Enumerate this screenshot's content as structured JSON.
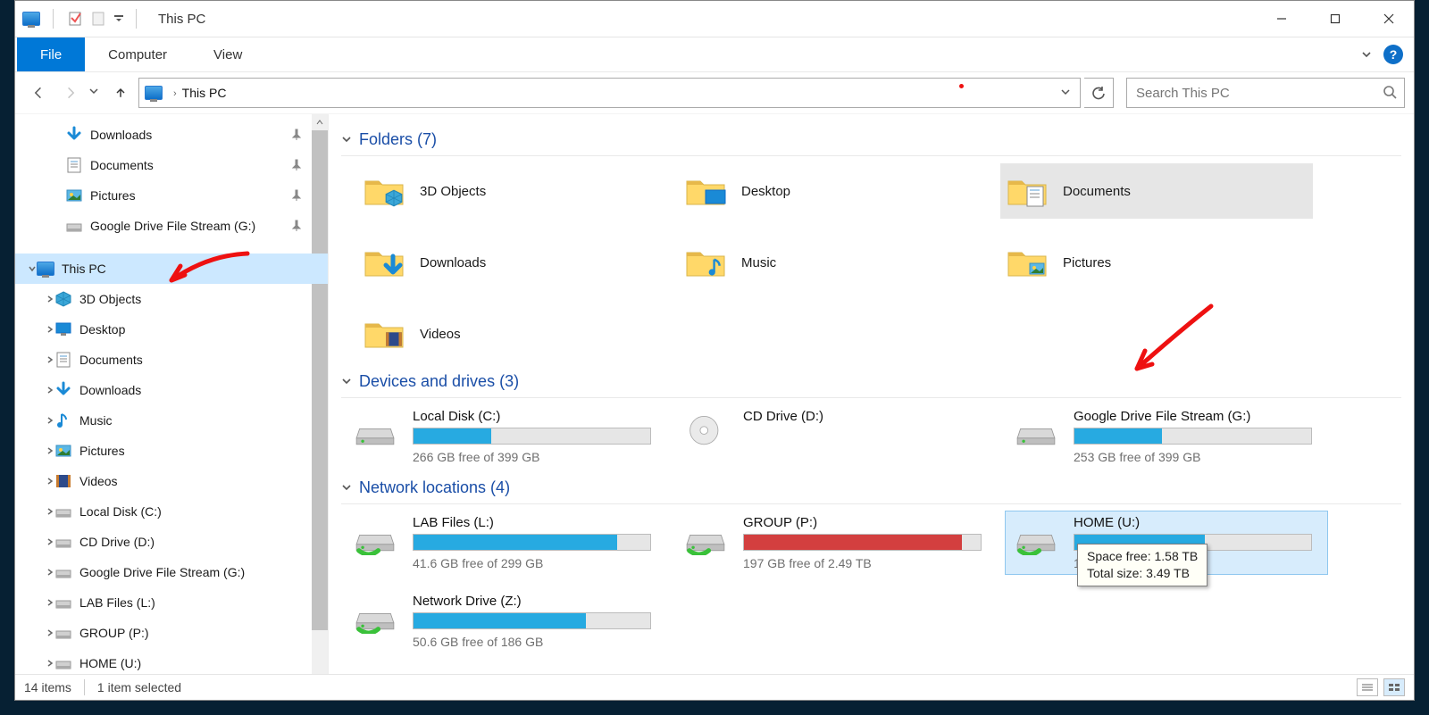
{
  "window_title": "This PC",
  "ribbon": {
    "file": "File",
    "computer": "Computer",
    "view": "View"
  },
  "breadcrumb": {
    "root": "This PC"
  },
  "search_placeholder": "Search This PC",
  "nav": {
    "quick": [
      {
        "label": "Downloads",
        "icon": "download"
      },
      {
        "label": "Documents",
        "icon": "document"
      },
      {
        "label": "Pictures",
        "icon": "pictures"
      },
      {
        "label": "Google Drive File Stream (G:)",
        "icon": "drive"
      }
    ],
    "this_pc_label": "This PC",
    "children": [
      {
        "label": "3D Objects",
        "icon": "3d"
      },
      {
        "label": "Desktop",
        "icon": "desktop"
      },
      {
        "label": "Documents",
        "icon": "document"
      },
      {
        "label": "Downloads",
        "icon": "download"
      },
      {
        "label": "Music",
        "icon": "music"
      },
      {
        "label": "Pictures",
        "icon": "pictures"
      },
      {
        "label": "Videos",
        "icon": "videos"
      },
      {
        "label": "Local Disk (C:)",
        "icon": "hdd"
      },
      {
        "label": "CD Drive (D:)",
        "icon": "cd"
      },
      {
        "label": "Google Drive File Stream (G:)",
        "icon": "hdd"
      },
      {
        "label": "LAB Files (L:)",
        "icon": "net"
      },
      {
        "label": "GROUP (P:)",
        "icon": "net"
      },
      {
        "label": "HOME (U:)",
        "icon": "net"
      }
    ]
  },
  "sections": {
    "folders_title": "Folders (7)",
    "devices_title": "Devices and drives (3)",
    "network_title": "Network locations (4)"
  },
  "folders": [
    {
      "label": "3D Objects",
      "icon": "3d"
    },
    {
      "label": "Desktop",
      "icon": "desktop"
    },
    {
      "label": "Documents",
      "icon": "document",
      "selected": true
    },
    {
      "label": "Downloads",
      "icon": "download"
    },
    {
      "label": "Music",
      "icon": "music"
    },
    {
      "label": "Pictures",
      "icon": "pictures"
    },
    {
      "label": "Videos",
      "icon": "videos"
    }
  ],
  "drives": [
    {
      "label": "Local Disk (C:)",
      "sub": "266 GB free of 399 GB",
      "fill": 33,
      "icon": "hdd"
    },
    {
      "label": "CD Drive (D:)",
      "sub": "",
      "fill": null,
      "icon": "cd"
    },
    {
      "label": "Google Drive File Stream (G:)",
      "sub": "253 GB free of 399 GB",
      "fill": 37,
      "icon": "hdd"
    }
  ],
  "network": [
    {
      "label": "LAB Files (L:)",
      "sub": "41.6 GB free of 299 GB",
      "fill": 86,
      "icon": "net"
    },
    {
      "label": "GROUP (P:)",
      "sub": "197 GB free of 2.49 TB",
      "fill": 92,
      "color": "red",
      "icon": "net"
    },
    {
      "label": "HOME (U:)",
      "sub": "1.",
      "fill": 55,
      "icon": "net",
      "selected": true,
      "tooltip": {
        "line1": "Space free: 1.58 TB",
        "line2": "Total size: 3.49 TB"
      }
    },
    {
      "label": "Network Drive (Z:)",
      "sub": "50.6 GB free of 186 GB",
      "fill": 73,
      "icon": "net"
    }
  ],
  "status": {
    "items": "14 items",
    "selected": "1 item selected"
  }
}
